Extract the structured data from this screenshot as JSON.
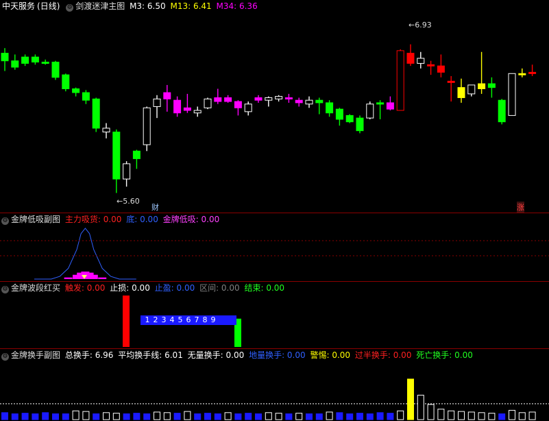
{
  "main": {
    "stock_name": "中天服务",
    "period": "(日线)",
    "indicator": "剑渡迷津主图",
    "ma": [
      {
        "label": "M3: 6.50",
        "color": "#ffffff"
      },
      {
        "label": "M13: 6.41",
        "color": "#ffff00"
      },
      {
        "label": "M34: 6.36",
        "color": "#ff00ff"
      }
    ],
    "high_mark": "6.93",
    "low_mark": "5.60",
    "tag_cai": "财",
    "tag_zhang": "涨"
  },
  "sub1": {
    "title": "金牌低吸副图",
    "items": [
      {
        "label": "主力吸货: 0.00",
        "color": "#ff2020"
      },
      {
        "label": "底: 0.00",
        "color": "#3060ff"
      },
      {
        "label": "金牌低吸: 0.00",
        "color": "#ff40ff"
      }
    ]
  },
  "sub2": {
    "title": "金牌波段红买",
    "items": [
      {
        "label": "触发: 0.00",
        "color": "#ff2020"
      },
      {
        "label": "止损: 0.00",
        "color": "#ffffff"
      },
      {
        "label": "止盈: 0.00",
        "color": "#3060ff"
      },
      {
        "label": "区间: 0.00",
        "color": "#808080"
      },
      {
        "label": "结束: 0.00",
        "color": "#20ff20"
      }
    ],
    "counter": [
      "1",
      "2",
      "3",
      "4",
      "5",
      "6",
      "7",
      "8",
      "9"
    ]
  },
  "sub3": {
    "title": "金牌换手副图",
    "items": [
      {
        "label": "总换手: 6.96",
        "color": "#ffffff"
      },
      {
        "label": "平均换手线: 6.01",
        "color": "#ffffff"
      },
      {
        "label": "无量换手: 0.00",
        "color": "#ffffff"
      },
      {
        "label": "地量换手: 0.00",
        "color": "#3060ff"
      },
      {
        "label": "警惕: 0.00",
        "color": "#ffff00"
      },
      {
        "label": "过半换手: 0.00",
        "color": "#ff2020"
      },
      {
        "label": "死亡换手: 0.00",
        "color": "#20ff20"
      }
    ]
  },
  "chart_data": [
    {
      "type": "candlestick",
      "title": "剑渡迷津主图",
      "ylim": [
        5.5,
        7.0
      ],
      "marked_high": 6.93,
      "marked_low": 5.6,
      "candles": [
        {
          "o": 6.7,
          "h": 6.74,
          "l": 6.56,
          "c": 6.64,
          "color": "green"
        },
        {
          "o": 6.64,
          "h": 6.69,
          "l": 6.57,
          "c": 6.59,
          "color": "green"
        },
        {
          "o": 6.62,
          "h": 6.69,
          "l": 6.6,
          "c": 6.67,
          "color": "green"
        },
        {
          "o": 6.67,
          "h": 6.69,
          "l": 6.61,
          "c": 6.63,
          "color": "green"
        },
        {
          "o": 6.63,
          "h": 6.65,
          "l": 6.61,
          "c": 6.62,
          "color": "green"
        },
        {
          "o": 6.63,
          "h": 6.64,
          "l": 6.49,
          "c": 6.51,
          "color": "green"
        },
        {
          "o": 6.53,
          "h": 6.54,
          "l": 6.4,
          "c": 6.42,
          "color": "green"
        },
        {
          "o": 6.42,
          "h": 6.43,
          "l": 6.36,
          "c": 6.39,
          "color": "green"
        },
        {
          "o": 6.39,
          "h": 6.41,
          "l": 6.3,
          "c": 6.33,
          "color": "green"
        },
        {
          "o": 6.34,
          "h": 6.35,
          "l": 6.08,
          "c": 6.11,
          "color": "green"
        },
        {
          "o": 6.11,
          "h": 6.15,
          "l": 6.03,
          "c": 6.08,
          "color": "white"
        },
        {
          "o": 6.08,
          "h": 6.1,
          "l": 5.6,
          "c": 5.71,
          "color": "green"
        },
        {
          "o": 5.71,
          "h": 5.85,
          "l": 5.65,
          "c": 5.83,
          "color": "white"
        },
        {
          "o": 5.93,
          "h": 5.94,
          "l": 5.79,
          "c": 5.87,
          "color": "green"
        },
        {
          "o": 5.98,
          "h": 6.28,
          "l": 5.93,
          "c": 6.27,
          "color": "white"
        },
        {
          "o": 6.28,
          "h": 6.37,
          "l": 6.19,
          "c": 6.34,
          "color": "white"
        },
        {
          "o": 6.34,
          "h": 6.45,
          "l": 6.24,
          "c": 6.39,
          "color": "magenta"
        },
        {
          "o": 6.33,
          "h": 6.36,
          "l": 6.2,
          "c": 6.23,
          "color": "magenta"
        },
        {
          "o": 6.25,
          "h": 6.38,
          "l": 6.23,
          "c": 6.27,
          "color": "magenta"
        },
        {
          "o": 6.23,
          "h": 6.28,
          "l": 6.2,
          "c": 6.25,
          "color": "white"
        },
        {
          "o": 6.27,
          "h": 6.35,
          "l": 6.26,
          "c": 6.34,
          "color": "white"
        },
        {
          "o": 6.32,
          "h": 6.42,
          "l": 6.3,
          "c": 6.35,
          "color": "magenta"
        },
        {
          "o": 6.35,
          "h": 6.37,
          "l": 6.31,
          "c": 6.32,
          "color": "magenta"
        },
        {
          "o": 6.32,
          "h": 6.33,
          "l": 6.21,
          "c": 6.27,
          "color": "magenta"
        },
        {
          "o": 6.24,
          "h": 6.32,
          "l": 6.21,
          "c": 6.3,
          "color": "white"
        },
        {
          "o": 6.33,
          "h": 6.37,
          "l": 6.31,
          "c": 6.35,
          "color": "magenta"
        },
        {
          "o": 6.33,
          "h": 6.36,
          "l": 6.28,
          "c": 6.35,
          "color": "white"
        },
        {
          "o": 6.34,
          "h": 6.37,
          "l": 6.32,
          "c": 6.36,
          "color": "white"
        },
        {
          "o": 6.35,
          "h": 6.38,
          "l": 6.31,
          "c": 6.35,
          "color": "magenta"
        },
        {
          "o": 6.33,
          "h": 6.35,
          "l": 6.28,
          "c": 6.31,
          "color": "magenta"
        },
        {
          "o": 6.33,
          "h": 6.36,
          "l": 6.27,
          "c": 6.3,
          "color": "white"
        },
        {
          "o": 6.33,
          "h": 6.35,
          "l": 6.22,
          "c": 6.31,
          "color": "green"
        },
        {
          "o": 6.31,
          "h": 6.33,
          "l": 6.2,
          "c": 6.23,
          "color": "green"
        },
        {
          "o": 6.26,
          "h": 6.27,
          "l": 6.13,
          "c": 6.18,
          "color": "green"
        },
        {
          "o": 6.21,
          "h": 6.22,
          "l": 6.15,
          "c": 6.16,
          "color": "green"
        },
        {
          "o": 6.19,
          "h": 6.21,
          "l": 6.07,
          "c": 6.09,
          "color": "green"
        },
        {
          "o": 6.19,
          "h": 6.32,
          "l": 6.18,
          "c": 6.3,
          "color": "white"
        },
        {
          "o": 6.31,
          "h": 6.33,
          "l": 6.18,
          "c": 6.31,
          "color": "green"
        },
        {
          "o": 6.31,
          "h": 6.36,
          "l": 6.25,
          "c": 6.26,
          "color": "magenta"
        },
        {
          "o": 6.25,
          "h": 6.73,
          "l": 6.25,
          "c": 6.72,
          "color": "hollow-red"
        },
        {
          "o": 6.7,
          "h": 6.77,
          "l": 6.6,
          "c": 6.62,
          "color": "red"
        },
        {
          "o": 6.66,
          "h": 6.71,
          "l": 6.58,
          "c": 6.62,
          "color": "white"
        },
        {
          "o": 6.61,
          "h": 6.64,
          "l": 6.53,
          "c": 6.6,
          "color": "red"
        },
        {
          "o": 6.6,
          "h": 6.69,
          "l": 6.51,
          "c": 6.55,
          "color": "red"
        },
        {
          "o": 6.48,
          "h": 6.52,
          "l": 6.32,
          "c": 6.47,
          "color": "red"
        },
        {
          "o": 6.35,
          "h": 6.5,
          "l": 6.31,
          "c": 6.43,
          "color": "yellow"
        },
        {
          "o": 6.38,
          "h": 6.45,
          "l": 6.36,
          "c": 6.45,
          "color": "white"
        },
        {
          "o": 6.42,
          "h": 6.71,
          "l": 6.38,
          "c": 6.46,
          "color": "yellow"
        },
        {
          "o": 6.46,
          "h": 6.51,
          "l": 6.35,
          "c": 6.43,
          "color": "green"
        },
        {
          "o": 6.33,
          "h": 6.34,
          "l": 6.14,
          "c": 6.16,
          "color": "green"
        },
        {
          "o": 6.21,
          "h": 6.54,
          "l": 6.21,
          "c": 6.54,
          "color": "hollow-white"
        },
        {
          "o": 6.54,
          "h": 6.58,
          "l": 6.51,
          "c": 6.54,
          "color": "yellow"
        },
        {
          "o": 6.54,
          "h": 6.61,
          "l": 6.52,
          "c": 6.55,
          "color": "red"
        }
      ]
    },
    {
      "type": "area",
      "title": "金牌低吸副图",
      "x": [
        0,
        2,
        4,
        6,
        8,
        10,
        11,
        12,
        13,
        14,
        16,
        18,
        20,
        22,
        24
      ],
      "series": [
        {
          "name": "底",
          "values": [
            0,
            0,
            0,
            0.05,
            0.2,
            0.55,
            0.85,
            0.95,
            0.85,
            0.55,
            0.2,
            0.05,
            0,
            0,
            0
          ]
        },
        {
          "name": "主力吸货",
          "values": [
            0,
            0,
            0,
            0,
            0.03,
            0.08,
            0.12,
            0.14,
            0.12,
            0.08,
            0.03,
            0,
            0,
            0,
            0
          ]
        }
      ]
    },
    {
      "type": "bar",
      "title": "金牌波段红买",
      "categories": [
        "触发",
        "结束"
      ],
      "values": [
        1,
        0.55
      ]
    },
    {
      "type": "bar",
      "title": "金牌换手副图",
      "ylim": [
        0,
        10
      ],
      "average_line": 6.01,
      "values": [
        1.2,
        1.0,
        1.1,
        1.0,
        1.2,
        1.0,
        1.0,
        1.5,
        1.4,
        1.0,
        1.2,
        1.1,
        1.0,
        1.1,
        1.0,
        1.3,
        1.2,
        1.1,
        1.4,
        1.0,
        1.1,
        1.0,
        1.2,
        1.0,
        1.1,
        1.0,
        1.2,
        1.1,
        1.0,
        1.1,
        1.0,
        1.0,
        1.3,
        1.2,
        1.0,
        1.1,
        1.0,
        1.2,
        1.1,
        1.5,
        6.96,
        4.2,
        2.6,
        1.8,
        1.5,
        1.4,
        1.3,
        1.2,
        1.1,
        1.0,
        1.6,
        1.2,
        1.3
      ],
      "colors": [
        "blue",
        "blue",
        "blue",
        "blue",
        "blue",
        "blue",
        "blue",
        "white",
        "white",
        "blue",
        "white",
        "white",
        "blue",
        "blue",
        "blue",
        "white",
        "white",
        "blue",
        "white",
        "blue",
        "blue",
        "blue",
        "white",
        "blue",
        "blue",
        "blue",
        "white",
        "white",
        "blue",
        "white",
        "blue",
        "blue",
        "white",
        "blue",
        "blue",
        "blue",
        "blue",
        "blue",
        "blue",
        "white",
        "yellow",
        "white",
        "white",
        "white",
        "white",
        "white",
        "white",
        "white",
        "white",
        "blue",
        "white",
        "white",
        "white"
      ]
    }
  ]
}
